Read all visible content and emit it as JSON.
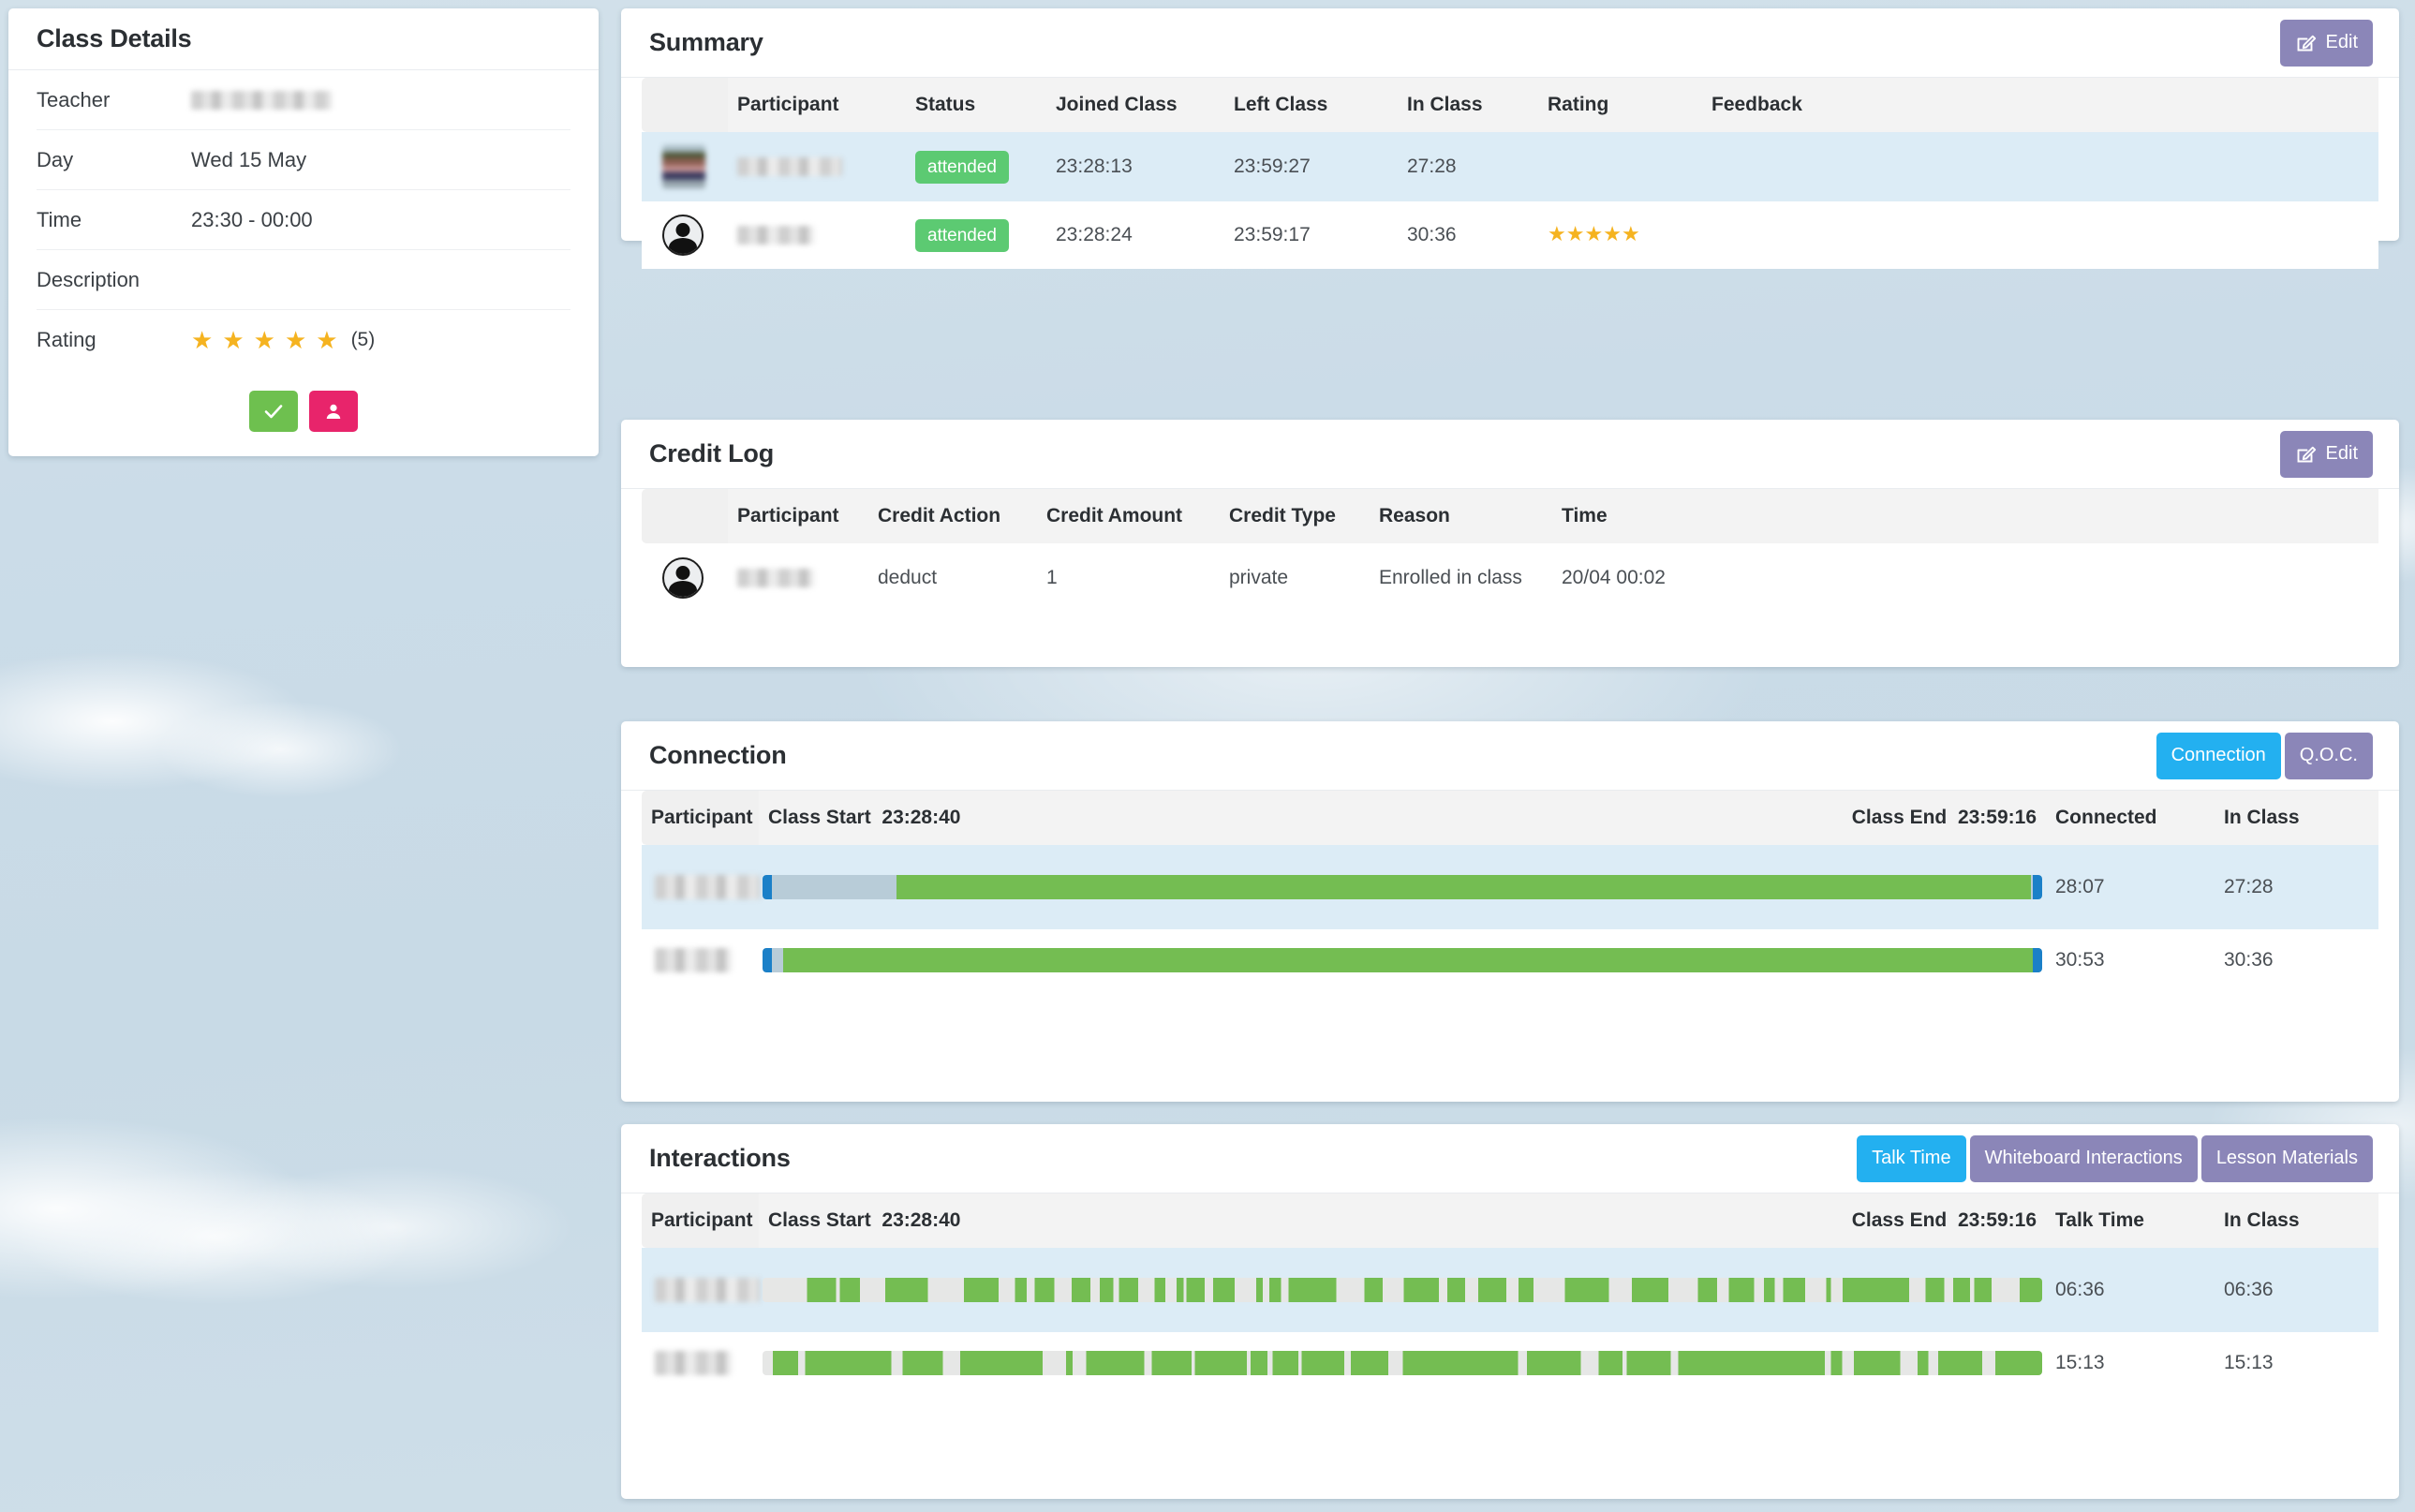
{
  "class_details": {
    "title": "Class Details",
    "rows": [
      {
        "label": "Teacher",
        "value": "",
        "type": "blur",
        "blur_width": 150
      },
      {
        "label": "Day",
        "value": "Wed 15 May",
        "type": "text"
      },
      {
        "label": "Time",
        "value": "23:30 - 00:00",
        "type": "text"
      },
      {
        "label": "Description",
        "value": "",
        "type": "text"
      },
      {
        "label": "Rating",
        "value": "",
        "type": "stars",
        "stars": 5,
        "count_label": "(5)"
      }
    ],
    "confirm_button_icon": "check-icon",
    "profile_button_icon": "person-icon"
  },
  "summary": {
    "title": "Summary",
    "edit_label": "Edit",
    "edit_icon": "pencil-square-icon",
    "columns": [
      "",
      "Participant",
      "Status",
      "Joined Class",
      "Left Class",
      "In Class",
      "Rating",
      "Feedback"
    ],
    "rows": [
      {
        "avatar": "photo",
        "participant": "",
        "participant_blur_width": 112,
        "status": "attended",
        "joined_class": "23:28:13",
        "left_class": "23:59:27",
        "in_class": "27:28",
        "rating": 0,
        "feedback": "",
        "highlight": true
      },
      {
        "avatar": "default",
        "participant": "",
        "participant_blur_width": 82,
        "status": "attended",
        "joined_class": "23:28:24",
        "left_class": "23:59:17",
        "in_class": "30:36",
        "rating": 5,
        "feedback": "",
        "highlight": false
      }
    ]
  },
  "credit_log": {
    "title": "Credit Log",
    "edit_label": "Edit",
    "edit_icon": "pencil-square-icon",
    "columns": [
      "",
      "Participant",
      "Credit Action",
      "Credit Amount",
      "Credit Type",
      "Reason",
      "Time"
    ],
    "rows": [
      {
        "avatar": "default",
        "participant": "",
        "participant_blur_width": 82,
        "credit_action": "deduct",
        "credit_amount": "1",
        "credit_type": "private",
        "reason": "Enrolled in class",
        "time": "20/04 00:02",
        "highlight": false
      }
    ]
  },
  "connection": {
    "title": "Connection",
    "tabs": [
      {
        "label": "Connection",
        "active": true
      },
      {
        "label": "Q.O.C.",
        "active": false
      }
    ],
    "columns": {
      "participant": "Participant",
      "class_start_label": "Class Start",
      "class_start_time": "23:28:40",
      "class_end_label": "Class End",
      "class_end_time": "23:59:16",
      "connected": "Connected",
      "in_class": "In Class"
    },
    "rows": [
      {
        "participant": "",
        "participant_blur_width": 112,
        "connected": "28:07",
        "in_class": "27:28",
        "highlight": true,
        "bar": {
          "start_pct": 0.9,
          "gap_end_pct": 10.5,
          "green_end_pct": 99.1
        }
      },
      {
        "participant": "",
        "participant_blur_width": 82,
        "connected": "30:53",
        "in_class": "30:36",
        "highlight": false,
        "bar": {
          "start_pct": 0.9,
          "gap_end_pct": 1.6,
          "green_end_pct": 99.8
        }
      }
    ]
  },
  "interactions": {
    "title": "Interactions",
    "tabs": [
      {
        "label": "Talk Time",
        "active": true
      },
      {
        "label": "Whiteboard Interactions",
        "active": false
      },
      {
        "label": "Lesson Materials",
        "active": false
      }
    ],
    "columns": {
      "participant": "Participant",
      "class_start_label": "Class Start",
      "class_start_time": "23:28:40",
      "class_end_label": "Class End",
      "class_end_time": "23:59:16",
      "talk_time": "Talk Time",
      "in_class": "In Class"
    },
    "rows": [
      {
        "participant": "",
        "participant_blur_width": 112,
        "talk_time": "06:36",
        "in_class": "06:36",
        "highlight": true,
        "density": 0.52,
        "seed": 7
      },
      {
        "participant": "",
        "participant_blur_width": 82,
        "talk_time": "15:13",
        "in_class": "15:13",
        "highlight": false,
        "density": 0.72,
        "seed": 23
      }
    ]
  },
  "colors": {
    "accent_purple": "#8b86b8",
    "accent_blue": "#23b0f0",
    "status_green": "#5cca72",
    "bar_green": "#74bd52",
    "bar_cap_blue": "#1b80c8",
    "star_gold": "#f5b320",
    "row_highlight": "#dcecf6",
    "confirm_green": "#6ec04f",
    "profile_pink": "#e8246b"
  }
}
